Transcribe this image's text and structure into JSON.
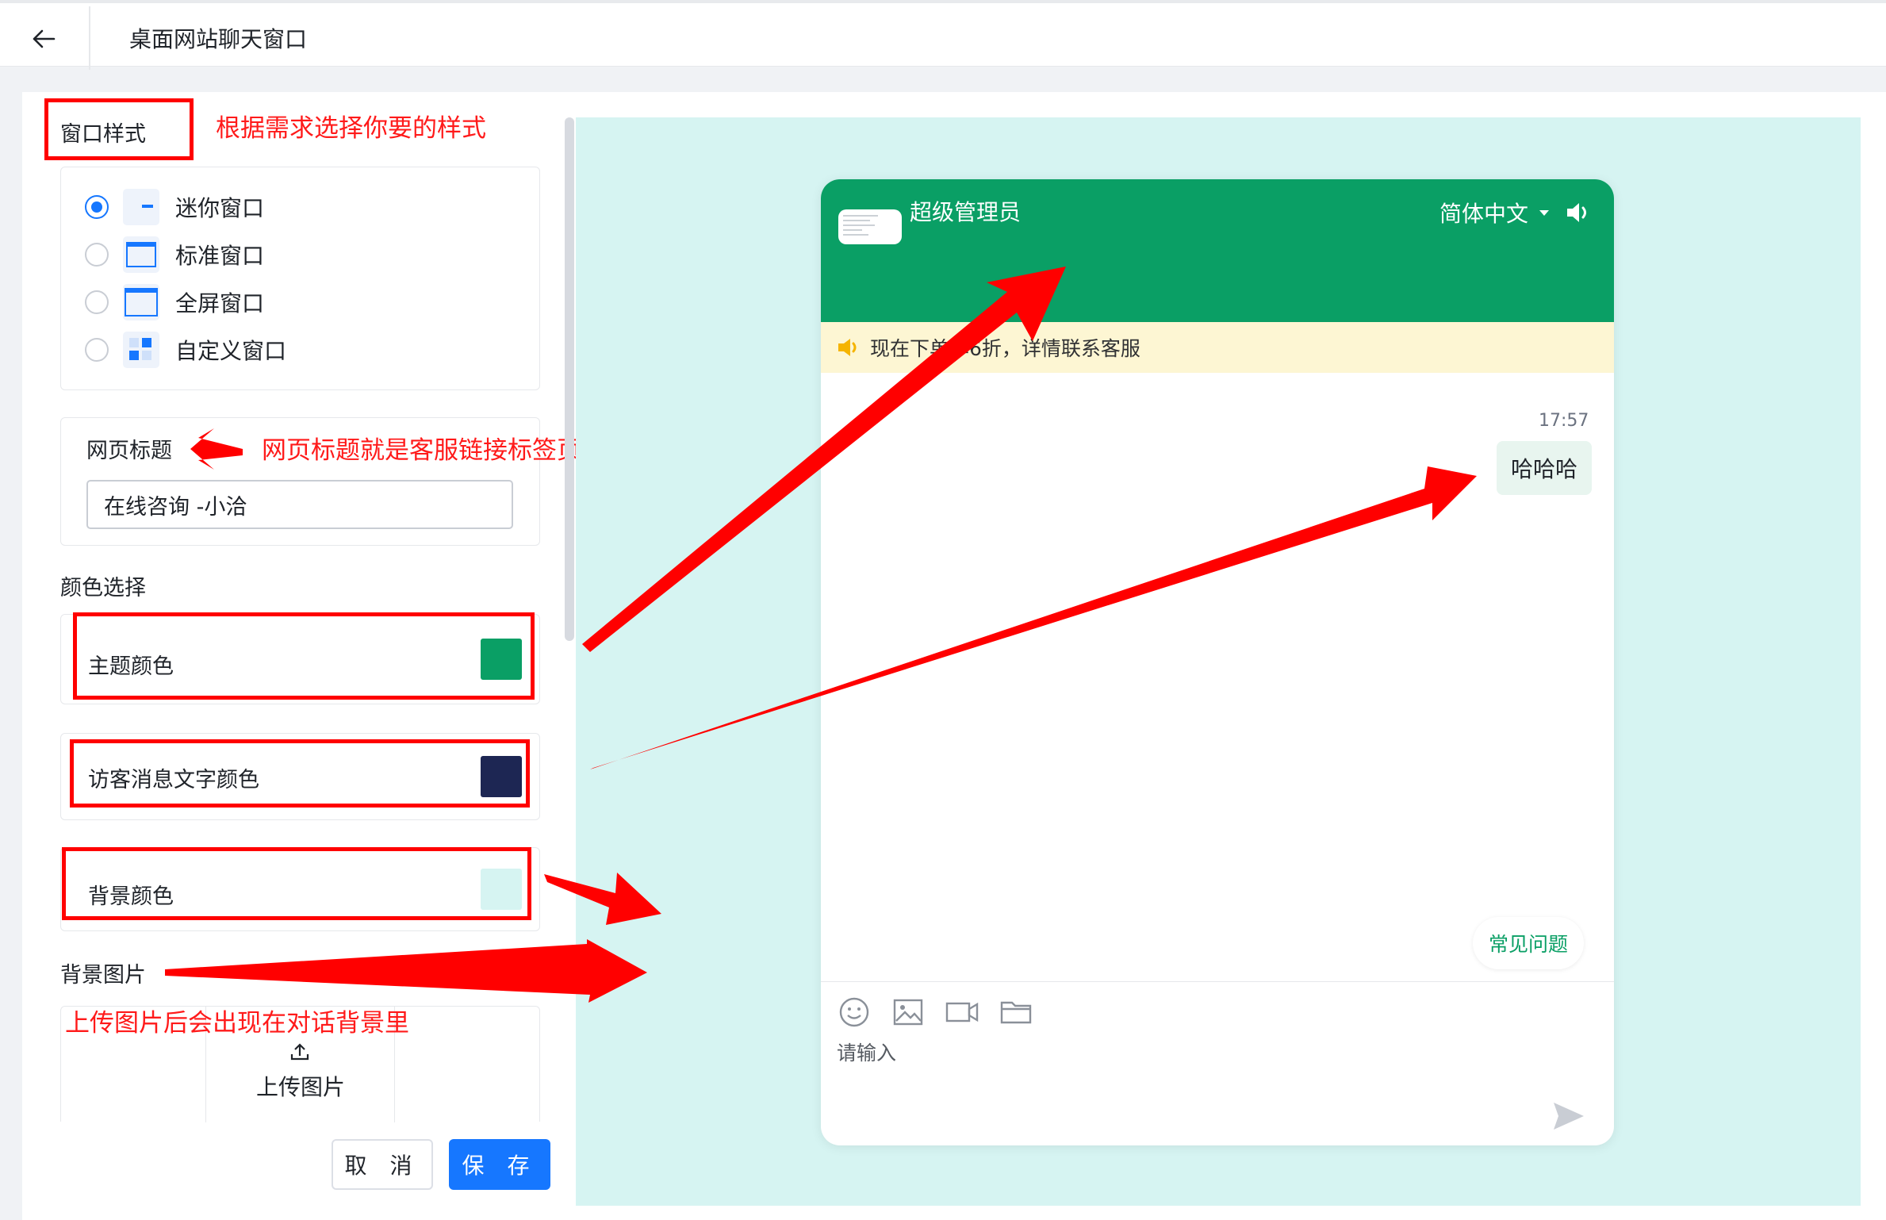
{
  "header": {
    "title": "桌面网站聊天窗口"
  },
  "window_style": {
    "label": "窗口样式",
    "options": [
      {
        "label": "迷你窗口",
        "selected": true
      },
      {
        "label": "标准窗口",
        "selected": false
      },
      {
        "label": "全屏窗口",
        "selected": false
      },
      {
        "label": "自定义窗口",
        "selected": false
      }
    ]
  },
  "page_title": {
    "label": "网页标题",
    "value": "在线咨询 -小洽"
  },
  "colors": {
    "section_label": "颜色选择",
    "theme": {
      "label": "主题颜色",
      "value": "#0a9f65"
    },
    "visitor_text": {
      "label": "访客消息文字颜色",
      "value": "#1d2653"
    },
    "background": {
      "label": "背景颜色",
      "value": "#d6f4f2"
    }
  },
  "background_image": {
    "label": "背景图片",
    "upload_label": "上传图片"
  },
  "actions": {
    "cancel": "取 消",
    "save": "保 存"
  },
  "annotations": {
    "window_style_note": "根据需求选择你要的样式",
    "page_title_note": "网页标题就是客服链接标签页名称",
    "upload_note": "上传图片后会出现在对话背景里"
  },
  "preview": {
    "agent_name": "超级管理员",
    "language": "简体中文",
    "notice": "现在下单享6折，详情联系客服",
    "message_time": "17:57",
    "message_text": "哈哈哈",
    "faq_label": "常见问题",
    "input_placeholder": "请输入",
    "icons": [
      "emoji-icon",
      "image-icon",
      "video-icon",
      "folder-icon",
      "send-icon",
      "speaker-icon"
    ]
  }
}
